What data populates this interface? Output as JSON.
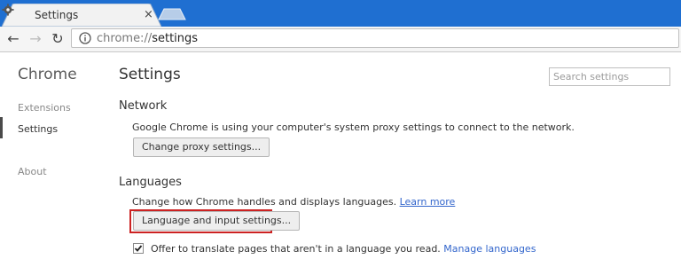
{
  "tab": {
    "title": "Settings",
    "close": "×"
  },
  "toolbar": {
    "url_scheme": "chrome://",
    "url_host": "settings"
  },
  "sidebar": {
    "title": "Chrome",
    "items": [
      {
        "label": "Extensions"
      },
      {
        "label": "Settings"
      },
      {
        "label": "About"
      }
    ]
  },
  "main": {
    "title": "Settings",
    "search_placeholder": "Search settings",
    "network": {
      "title": "Network",
      "description": "Google Chrome is using your computer's system proxy settings to connect to the network.",
      "button": "Change proxy settings..."
    },
    "languages": {
      "title": "Languages",
      "description": "Change how Chrome handles and displays languages.",
      "learn_more": "Learn more",
      "button": "Language and input settings...",
      "offer_text": "Offer to translate pages that aren't in a language you read.",
      "manage_languages": "Manage languages",
      "offer_checked": true
    }
  },
  "colors": {
    "tabstrip": "#1f6fd1",
    "link": "#3366cc",
    "highlight": "#cc2222"
  }
}
